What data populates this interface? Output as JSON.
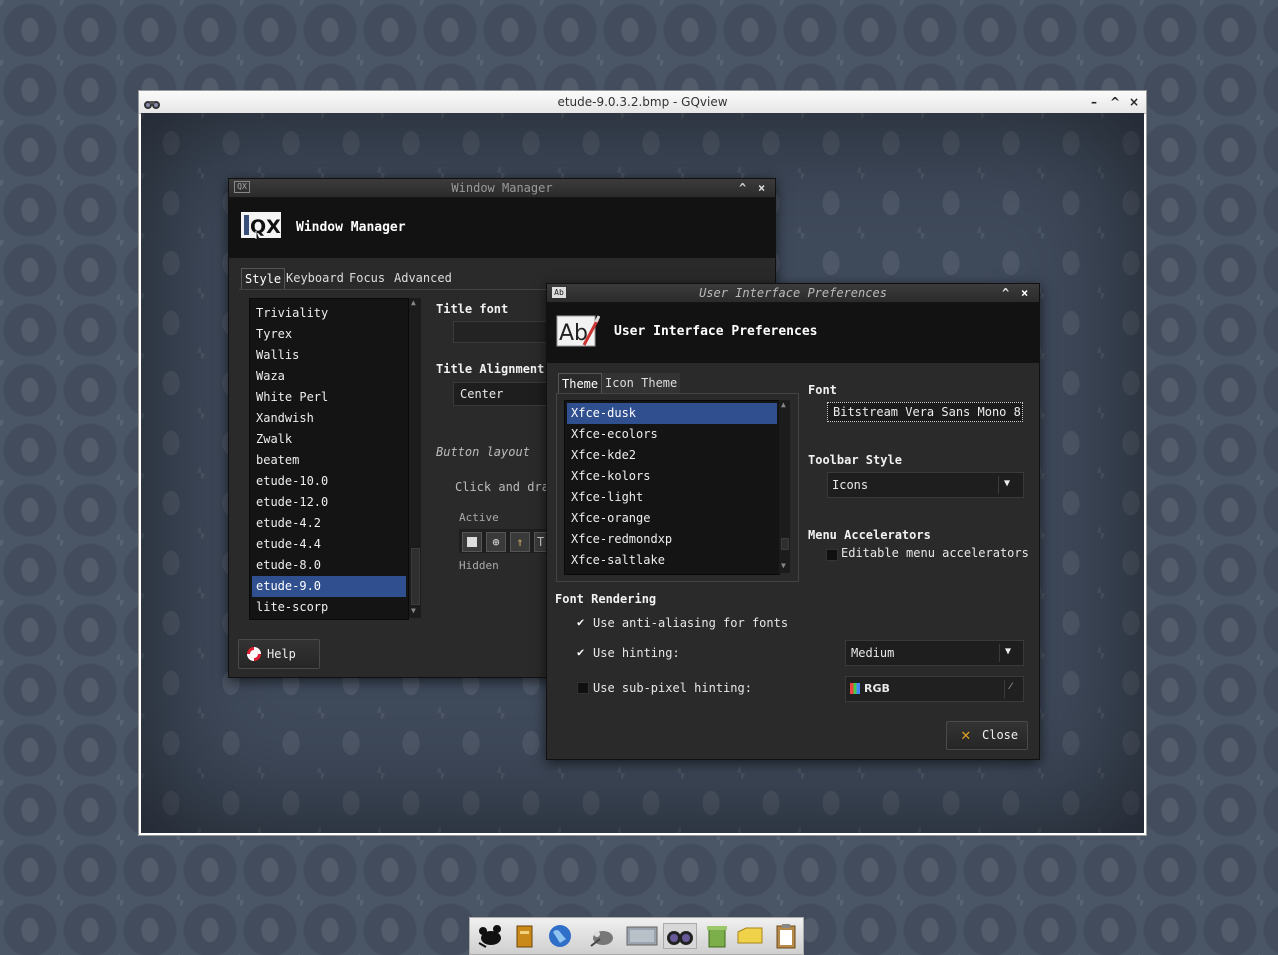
{
  "gqview": {
    "title": "etude-9.0.3.2.bmp - GQview",
    "controls": {
      "minimize": "–",
      "maximize": "^",
      "close": "×"
    }
  },
  "window_manager": {
    "titlebar": "Window Manager",
    "header_title": "Window Manager",
    "tabs": [
      "Style",
      "Keyboard",
      "Focus",
      "Advanced"
    ],
    "themes": [
      "Triviality",
      "Tyrex",
      "Wallis",
      "Waza",
      "White Perl",
      "Xandwish",
      "Zwalk",
      "beatem",
      "etude-10.0",
      "etude-12.0",
      "etude-4.2",
      "etude-4.4",
      "etude-8.0",
      "etude-9.0",
      "lite-scorp"
    ],
    "selected_theme": "etude-9.0",
    "title_font_label": "Title font",
    "title_alignment_label": "Title Alignment",
    "title_alignment_value": "Center",
    "button_layout_label": "Button layout",
    "click_drag_text": "Click and dra",
    "active_label": "Active",
    "hidden_label": "Hidden",
    "help_button": "Help"
  },
  "ui_prefs": {
    "titlebar": "User Interface Preferences",
    "header_title": "User Interface Preferences",
    "tabs": [
      "Theme",
      "Icon Theme"
    ],
    "themes": [
      "Xfce-dusk",
      "Xfce-ecolors",
      "Xfce-kde2",
      "Xfce-kolors",
      "Xfce-light",
      "Xfce-orange",
      "Xfce-redmondxp",
      "Xfce-saltlake"
    ],
    "selected_theme": "Xfce-dusk",
    "font_label": "Font",
    "font_value": "Bitstream Vera Sans Mono 8",
    "toolbar_style_label": "Toolbar Style",
    "toolbar_style_value": "Icons",
    "menu_accelerators_label": "Menu Accelerators",
    "editable_accelerators_label": "Editable menu accelerators",
    "editable_accelerators_checked": false,
    "font_rendering_label": "Font Rendering",
    "antialias_label": "Use anti-aliasing for fonts",
    "antialias_checked": true,
    "hinting_label": "Use hinting:",
    "hinting_checked": true,
    "hinting_value": "Medium",
    "subpixel_label": "Use sub-pixel hinting:",
    "subpixel_checked": false,
    "subpixel_value": "RGB",
    "close_button": "Close"
  },
  "taskbar": {
    "icons": [
      "mouse-icon",
      "book-icon",
      "globe-icon",
      "gimp-icon",
      "screen-icon",
      "binoculars-icon",
      "trash-icon",
      "folder-icon",
      "clipboard-icon"
    ]
  },
  "colors": {
    "selection": "#304f8f",
    "window_bg": "#2a2a2a",
    "header_bg": "#121212"
  }
}
